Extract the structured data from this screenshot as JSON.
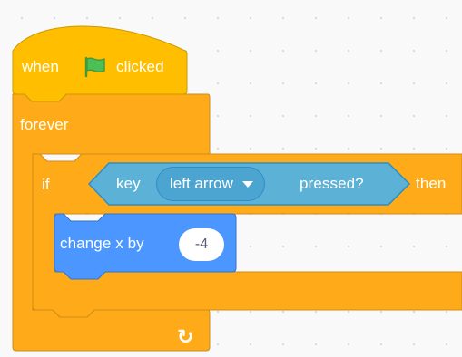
{
  "event_block": {
    "label_when": "when",
    "icon": "green-flag-icon",
    "label_clicked": "clicked"
  },
  "forever_block": {
    "label": "forever",
    "loop_icon": "↻"
  },
  "if_block": {
    "label_if": "if",
    "label_then": "then"
  },
  "sensing_block": {
    "label_key": "key",
    "dropdown_value": "left arrow",
    "label_pressed": "pressed?"
  },
  "motion_block": {
    "label": "change x by",
    "input_value": "-4"
  },
  "colors": {
    "events": "#ffbf00",
    "control": "#ffab19",
    "sensing": "#5cb1d6",
    "motion": "#4c97ff",
    "flag": "#4cbf56",
    "canvas": "#f9f9f9"
  }
}
